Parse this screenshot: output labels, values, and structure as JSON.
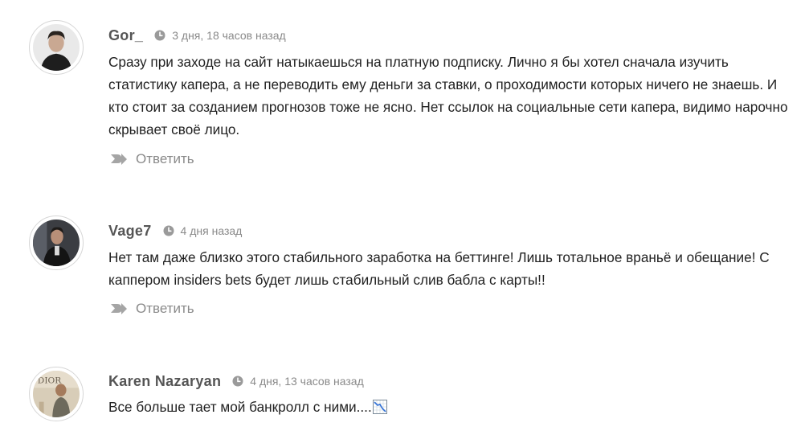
{
  "comments": [
    {
      "author": "Gor_",
      "date": "3 дня, 18 часов назад",
      "text": "Сразу при заходе на сайт натыкаешься на платную подписку. Лично я бы хотел сначала изучить статистику капера, а не переводить ему деньги за ставки, о проходимости которых ничего не знаешь. И кто стоит за созданием прогнозов тоже не ясно. Нет ссылок на социальные сети капера, видимо нарочно скрывает своё лицо.",
      "reply_label": "Ответить"
    },
    {
      "author": "Vage7",
      "date": "4 дня назад",
      "text": "Нет там даже близко этого стабильного заработка на беттинге! Лишь тотальное враньё и обещание! С каппером insiders bets будет лишь стабильный слив бабла с карты!!",
      "reply_label": "Ответить"
    },
    {
      "author": "Karen Nazaryan",
      "date": "4 дня, 13 часов назад",
      "text": "Все больше тает мой банкролл с ними....",
      "emoji": "chart-decreasing-emoji"
    }
  ],
  "icons": {
    "clock": "clock-icon",
    "reply": "reply-arrow-icon"
  },
  "colors": {
    "author": "#555555",
    "meta": "#8a8a8a",
    "text": "#222222",
    "reply": "#8a8a8a"
  }
}
